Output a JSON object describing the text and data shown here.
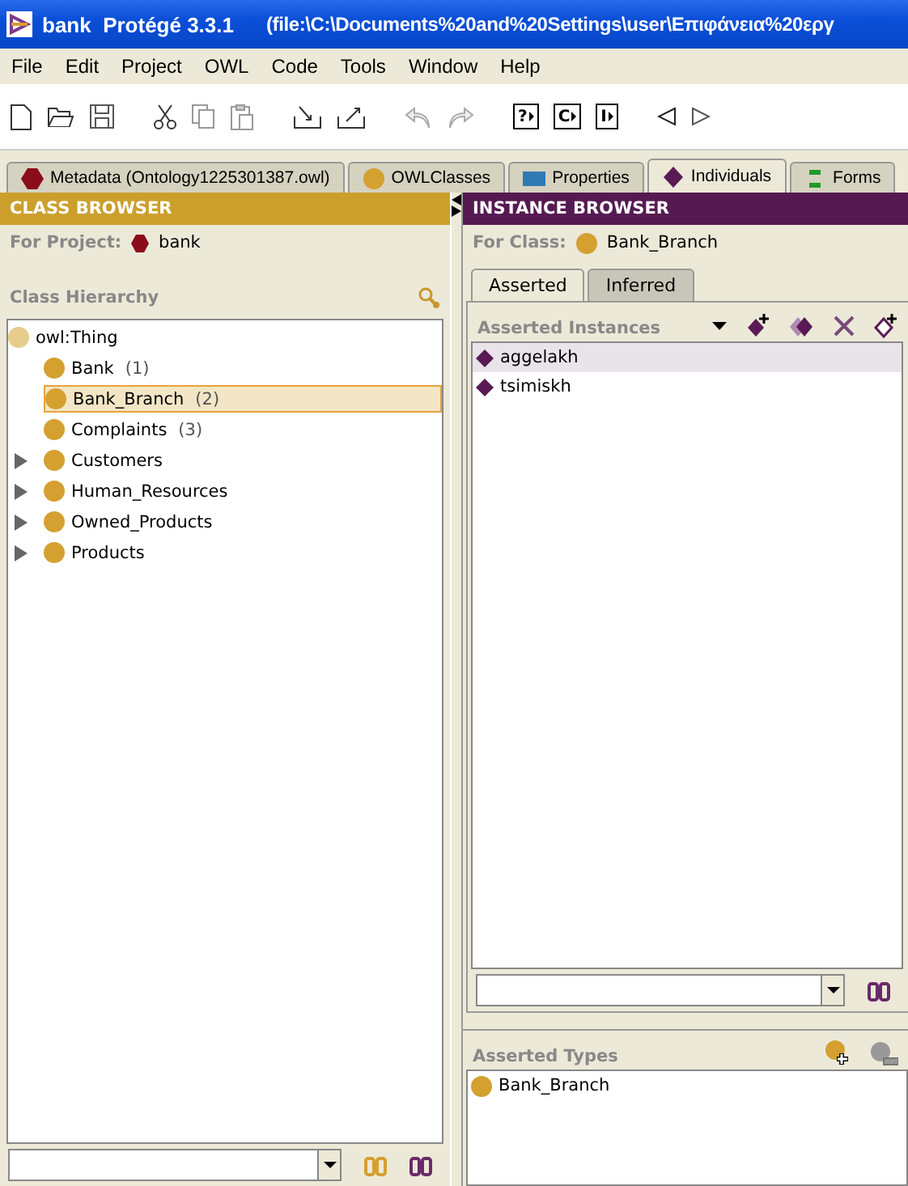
{
  "window": {
    "app": "bank  Protégé 3.3.1",
    "path": "(file:\\C:\\Documents%20and%20Settings\\user\\Επιφάνεια%20εργ"
  },
  "menu": [
    "File",
    "Edit",
    "Project",
    "OWL",
    "Code",
    "Tools",
    "Window",
    "Help"
  ],
  "toolbar": {
    "query_buttons": [
      "?",
      "C",
      "I"
    ]
  },
  "tabs": [
    {
      "label": "Metadata (Ontology1225301387.owl)",
      "kind": "hexagon",
      "color": "#8b0c1a",
      "selected": false
    },
    {
      "label": "OWLClasses",
      "kind": "circle",
      "color": "#d4a030",
      "selected": false
    },
    {
      "label": "Properties",
      "kind": "square",
      "color": "#2f7ab3",
      "selected": false
    },
    {
      "label": "Individuals",
      "kind": "diamond",
      "color": "#5a1a55",
      "selected": true
    },
    {
      "label": "Forms",
      "kind": "bars",
      "color": "#1f9a2a",
      "selected": false
    }
  ],
  "class_browser": {
    "title": "CLASS BROWSER",
    "project_label": "For Project:",
    "project": "bank",
    "hierarchy_label": "Class Hierarchy",
    "tree": {
      "label": "owl:Thing",
      "selected": false,
      "children": [
        {
          "label": "Bank",
          "count": "(1)",
          "selected": false,
          "expandable": false
        },
        {
          "label": "Bank_Branch",
          "count": "(2)",
          "selected": true,
          "expandable": false
        },
        {
          "label": "Complaints",
          "count": "(3)",
          "selected": false,
          "expandable": false
        },
        {
          "label": "Customers",
          "selected": false,
          "expandable": true
        },
        {
          "label": "Human_Resources",
          "selected": false,
          "expandable": true
        },
        {
          "label": "Owned_Products",
          "selected": false,
          "expandable": true
        },
        {
          "label": "Products",
          "selected": false,
          "expandable": true
        }
      ]
    }
  },
  "instance_browser": {
    "title": "INSTANCE BROWSER",
    "class_label": "For Class:",
    "class": "Bank_Branch",
    "tabs": [
      {
        "label": "Asserted",
        "selected": true
      },
      {
        "label": "Inferred",
        "selected": false
      }
    ],
    "instances_label": "Asserted Instances",
    "instances": [
      {
        "label": "aggelakh",
        "selected": true
      },
      {
        "label": "tsimiskh",
        "selected": false
      }
    ],
    "types_label": "Asserted Types",
    "types": [
      "Bank_Branch"
    ]
  }
}
